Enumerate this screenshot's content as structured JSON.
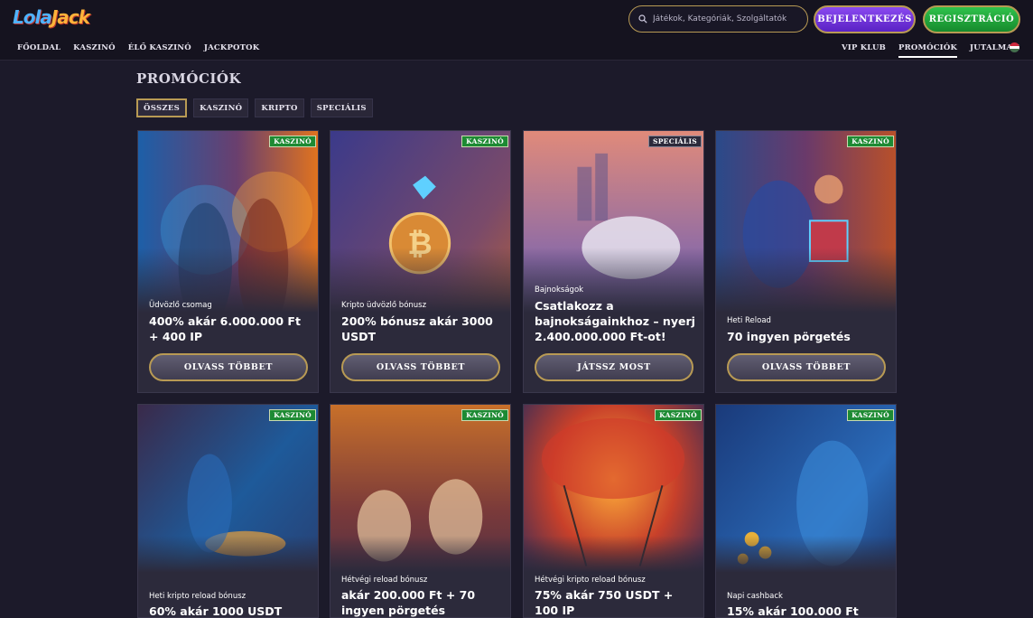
{
  "brand": {
    "logo_part1": "Lola",
    "logo_part2": "Jack"
  },
  "search": {
    "placeholder": "Játékok, Kategóriák, Szolgáltatók"
  },
  "header": {
    "login_label": "BEJELENTKEZÉS",
    "register_label": "REGISZTRÁCIÓ"
  },
  "nav_left": [
    "FŐOLDAL",
    "KASZINÓ",
    "ÉLŐ KASZINÓ",
    "JACKPOTOK"
  ],
  "nav_right": [
    "VIP KLUB",
    "PROMÓCIÓK",
    "JUTALMAK"
  ],
  "nav_active": "PROMÓCIÓK",
  "language_flag": {
    "icon": "hungary-flag-icon",
    "colors": [
      "#cd2a3e",
      "#ffffff",
      "#436f4d"
    ]
  },
  "page": {
    "title": "PROMÓCIÓK"
  },
  "filters": [
    "ÖSSZES",
    "KASZINÓ",
    "KRIPTO",
    "SPECIÁLIS"
  ],
  "filter_active": "ÖSSZES",
  "colors": {
    "accent_gold": "#b89a54",
    "login_purple": "#7a3ce8",
    "register_green": "#22a83c",
    "tag_green": "#1d8a33"
  },
  "promotions": [
    {
      "tag": "KASZINÓ",
      "subtitle": "Üdvözlő csomag",
      "headline": "400% akár 6.000.000 Ft + 400 IP",
      "cta": "OLVASS TÖBBET"
    },
    {
      "tag": "KASZINÓ",
      "subtitle": "Kripto üdvözlő bónusz",
      "headline": "200% bónusz akár 3000 USDT",
      "cta": "OLVASS TÖBBET"
    },
    {
      "tag": "SPECIÁLIS",
      "subtitle": "Bajnokságok",
      "headline": "Csatlakozz a bajnokságainkhoz – nyerj 2.400.000.000 Ft-ot!",
      "cta": "JÁTSSZ MOST"
    },
    {
      "tag": "KASZINÓ",
      "subtitle": "Heti Reload",
      "headline": "70 ingyen pörgetés",
      "cta": "OLVASS TÖBBET"
    },
    {
      "tag": "KASZINÓ",
      "subtitle": "Heti kripto reload bónusz",
      "headline": "60% akár 1000 USDT"
    },
    {
      "tag": "KASZINÓ",
      "subtitle": "Hétvégi reload bónusz",
      "headline": "akár 200.000 Ft + 70 ingyen pörgetés"
    },
    {
      "tag": "KASZINÓ",
      "subtitle": "Hétvégi kripto reload bónusz",
      "headline": "75% akár 750 USDT + 100 IP"
    },
    {
      "tag": "KASZINÓ",
      "subtitle": "Napi cashback",
      "headline": "15% akár 100.000 Ft"
    }
  ]
}
